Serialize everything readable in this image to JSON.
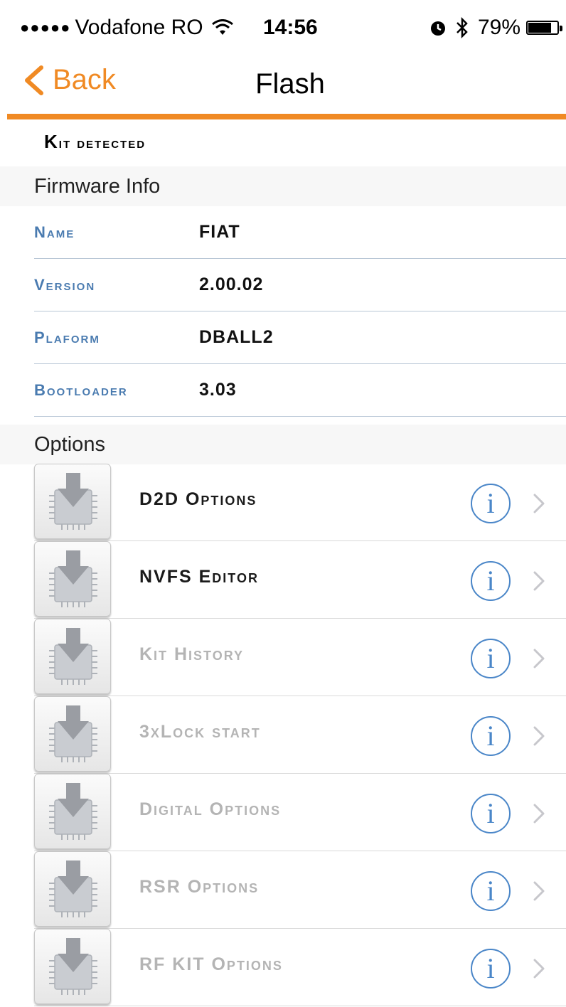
{
  "status_bar": {
    "signal": "●●●●●",
    "carrier": "Vodafone RO",
    "wifi_icon": "wifi-icon",
    "time": "14:56",
    "alarm_icon": "alarm-icon",
    "bluetooth_icon": "bluetooth-icon",
    "battery_percent": "79%",
    "battery_level": 0.79
  },
  "nav": {
    "back_label": "Back",
    "title": "Flash"
  },
  "accent_color": "#f08a24",
  "kit_status": "Kit detected",
  "firmware": {
    "header": "Firmware Info",
    "rows": [
      {
        "key": "Name",
        "value": "FIAT"
      },
      {
        "key": "Version",
        "value": "2.00.02"
      },
      {
        "key": "Plaform",
        "value": "DBALL2"
      },
      {
        "key": "Bootloader",
        "value": "3.03"
      }
    ]
  },
  "options": {
    "header": "Options",
    "items": [
      {
        "label": "D2D Options",
        "enabled": true
      },
      {
        "label": "NVFS Editor",
        "enabled": true
      },
      {
        "label": "Kit History",
        "enabled": false
      },
      {
        "label": "3xLock start",
        "enabled": false
      },
      {
        "label": "Digital Options",
        "enabled": false
      },
      {
        "label": "RSR Options",
        "enabled": false
      },
      {
        "label": "RF KIT Options",
        "enabled": false
      }
    ],
    "info_glyph": "i"
  }
}
